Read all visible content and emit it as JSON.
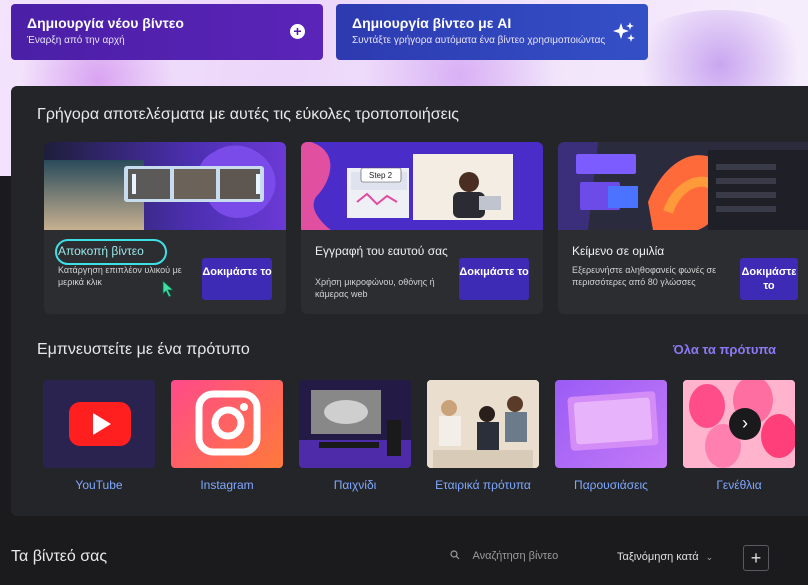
{
  "hero": {
    "create_new": {
      "title": "Δημιουργία νέου βίντεο",
      "subtitle": "Έναρξη από την αρχή"
    },
    "create_ai": {
      "title": "Δημιουργία βίντεο με AI",
      "subtitle": "Συντάξτε γρήγορα αυτόματα ένα βίντεο χρησιμοποιώντας"
    }
  },
  "quick_section": {
    "title": "Γρήγορα αποτελέσματα με αυτές τις εύκολες τροποποιήσεις",
    "cards": [
      {
        "title": "Αποκοπή βίντεο",
        "desc": "Κατάργηση επιπλέον υλικού με μερικά κλικ",
        "button": "Δοκιμάστε το"
      },
      {
        "title": "Εγγραφή του εαυτού σας",
        "desc": "Χρήση μικροφώνου, οθόνης ή κάμερας web",
        "button": "Δοκιμάστε το",
        "thumb_badge": "Step 2"
      },
      {
        "title": "Κείμενο σε ομιλία",
        "desc": "Εξερευνήστε αληθοφανείς φωνές σε περισσότερες από 80 γλώσσες",
        "button": "Δοκιμάστε το"
      }
    ]
  },
  "template_section": {
    "title": "Εμπνευστείτε με ένα πρότυπο",
    "see_all": "Όλα τα πρότυπα",
    "templates": [
      {
        "label": "YouTube",
        "icon": "youtube-icon"
      },
      {
        "label": "Instagram",
        "icon": "instagram-icon"
      },
      {
        "label": "Παιχνίδι",
        "icon": "gaming-setup"
      },
      {
        "label": "Εταιρικά πρότυπα",
        "icon": "office-team"
      },
      {
        "label": "Παρουσιάσεις",
        "icon": "presentation-slide"
      },
      {
        "label": "Γενέθλια",
        "icon": "balloons"
      }
    ]
  },
  "bottom": {
    "title": "Τα βίντεό σας",
    "search_placeholder": "Αναζήτηση βίντεο",
    "sort_label": "Ταξινόμηση κατά",
    "add_symbol": "+"
  },
  "colors": {
    "accent_purple": "#4b1fa6",
    "accent_blue": "#3450c7",
    "button": "#3d2bb5",
    "link": "#7fa8ff",
    "highlight": "#3fe0e4"
  }
}
